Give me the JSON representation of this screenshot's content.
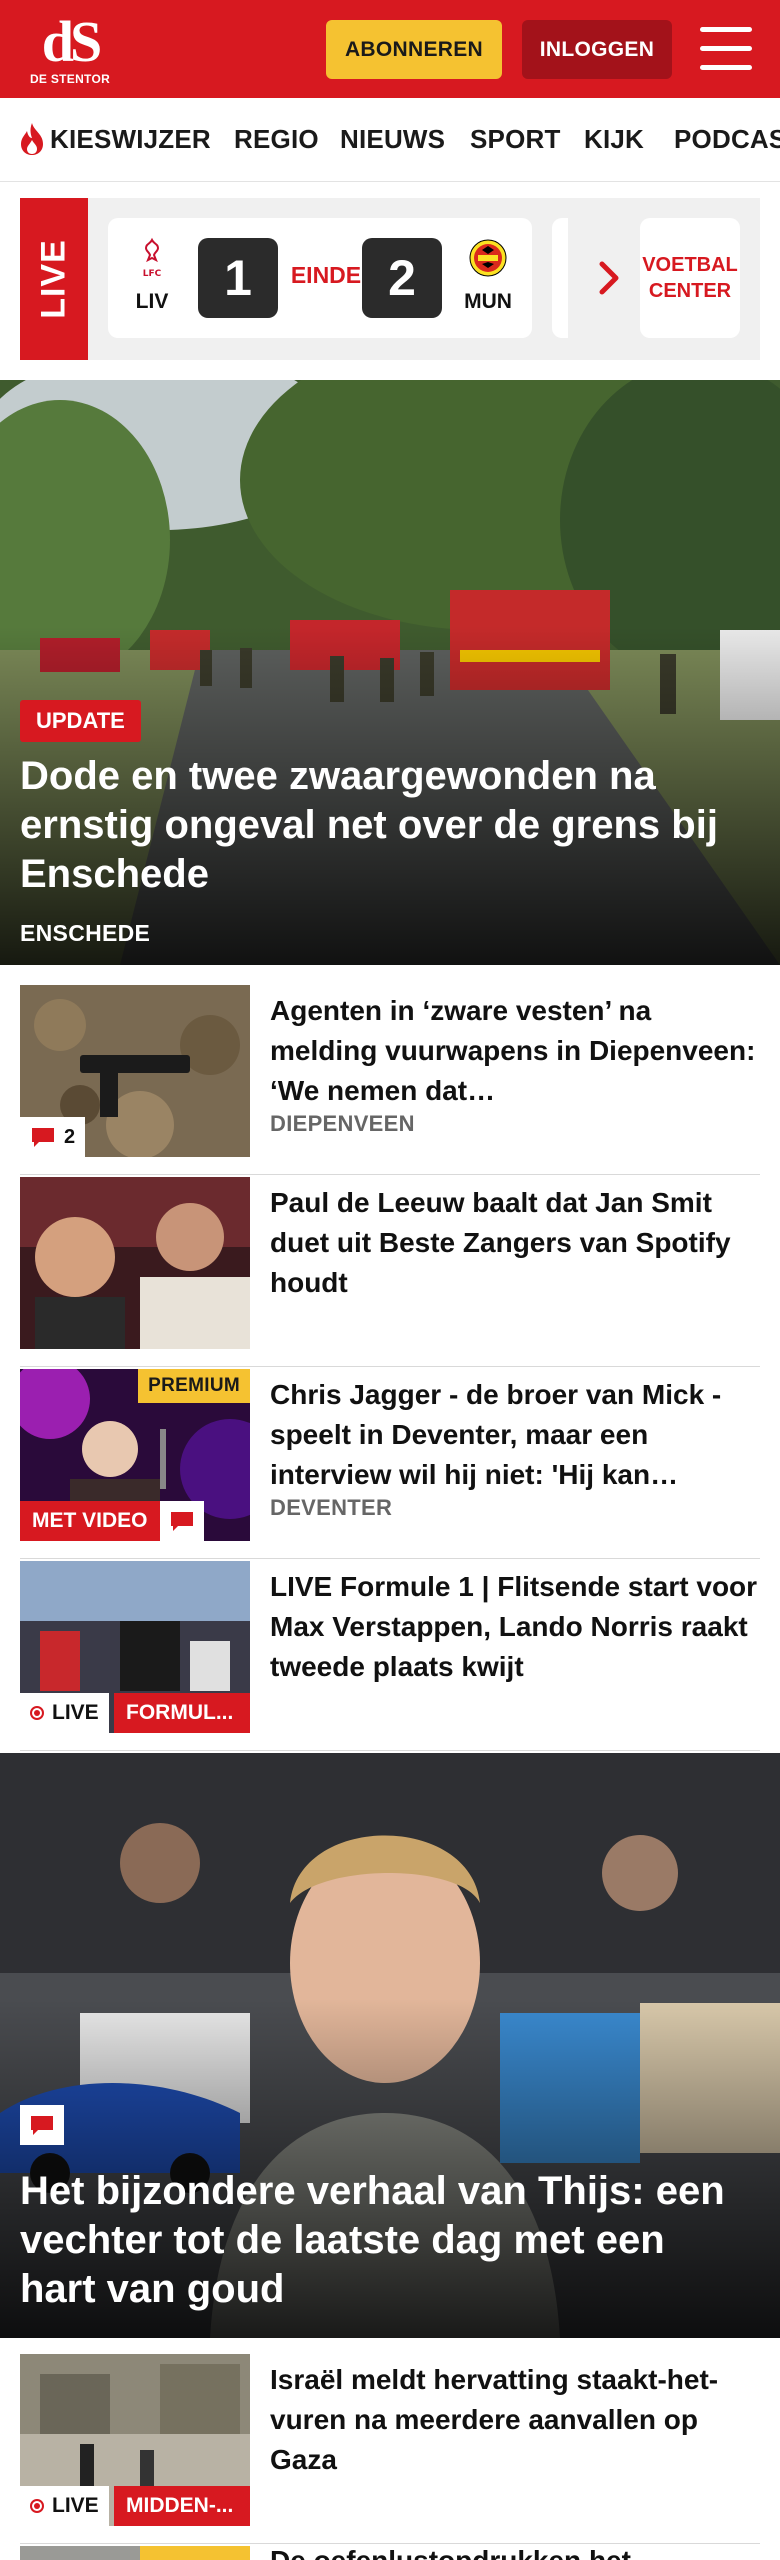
{
  "header": {
    "logo_mark": "dS",
    "logo_name": "DE STENTOR",
    "subscribe_label": "ABONNEREN",
    "login_label": "INLOGGEN",
    "brand_color": "#d71920"
  },
  "nav": {
    "items": [
      "KIESWIJZER",
      "REGIO",
      "NIEUWS",
      "SPORT",
      "KIJK",
      "PODCAS"
    ]
  },
  "live_scores": {
    "tag": "LIVE",
    "match": {
      "home": "LIV",
      "home_score": "1",
      "status": "EINDE",
      "away_score": "2",
      "away": "MUN"
    },
    "football_center_label": "VOETBAL CENTER"
  },
  "hero": {
    "badge": "UPDATE",
    "title": "Dode en twee zwaargewonden na ernstig ongeval net over de grens bij Enschede",
    "location": "ENSCHEDE"
  },
  "articles": [
    {
      "title": "Agenten in ‘zware vesten’ na melding vuurwapens in Diepenveen: ‘We nemen dat…",
      "location": "DIEPENVEEN",
      "comments": "2"
    },
    {
      "title": "Paul de Leeuw baalt dat Jan Smit duet uit Beste Zangers van Spotify houdt",
      "location": ""
    },
    {
      "title": "Chris Jagger - de broer van Mick - speelt in Deventer, maar een interview wil hij niet: 'Hij kan…",
      "location": "DEVENTER",
      "premium": "PREMIUM",
      "video_label": "MET VIDEO"
    },
    {
      "title": "LIVE Formule 1 | Flitsende start voor Max Verstappen, Lando Norris raakt tweede plaats kwijt",
      "live_label": "LIVE",
      "category": "FORMUL..."
    }
  ],
  "feature": {
    "title": "Het bijzondere verhaal van Thijs: een vechter tot de laatste dag met een hart van goud"
  },
  "articles_2": [
    {
      "title": "Israël meldt hervatting staakt-het-vuren na meerdere aanvallen op Gaza",
      "live_label": "LIVE",
      "category": "MIDDEN-..."
    },
    {
      "title": "De oefenlustopdrukken het..."
    }
  ]
}
